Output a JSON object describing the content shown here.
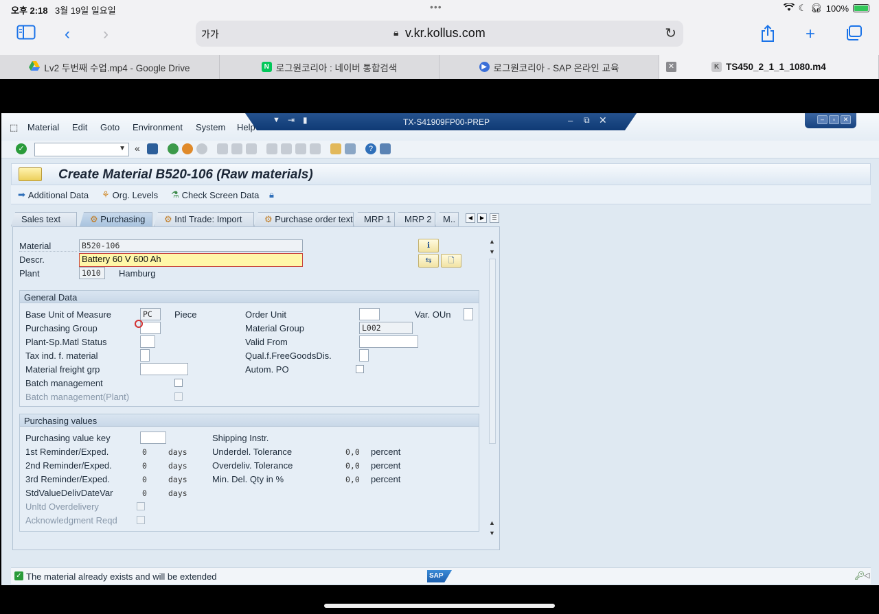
{
  "status_bar": {
    "time": "오후 2:18",
    "date": "3월 19일 일요일",
    "battery": "100%"
  },
  "browser": {
    "aa_label": "가가",
    "url": "v.kr.kollus.com",
    "tabs": [
      {
        "title": "Lv2 두번째 수업.mp4 - Google Drive",
        "icon": "google-drive-icon"
      },
      {
        "title": "로그원코리아 : 네이버 통합검색",
        "icon": "naver-icon"
      },
      {
        "title": "로그원코리아 - SAP 온라인 교육",
        "icon": "play-icon"
      },
      {
        "title": "TS450_2_1_1_1080.m4",
        "icon": "k-icon"
      }
    ]
  },
  "sap": {
    "menu": [
      "Material",
      "Edit",
      "Goto",
      "Environment",
      "System",
      "Help"
    ],
    "window_title": "TX-S41909FP00-PREP",
    "page_title": "Create Material B520-106 (Raw materials)",
    "app_toolbar": {
      "additional_data": "Additional Data",
      "org_levels": "Org. Levels",
      "check_screen": "Check Screen Data"
    },
    "tabs": [
      "Sales text",
      "Purchasing",
      "Intl Trade: Import",
      "Purchase order text",
      "MRP 1",
      "MRP 2",
      "M.."
    ],
    "active_tab": "Purchasing",
    "header": {
      "material_label": "Material",
      "material_value": "B520-106",
      "descr_label": "Descr.",
      "descr_value": "Battery 60 V 600 Ah",
      "plant_label": "Plant",
      "plant_value": "1010",
      "plant_name": "Hamburg"
    },
    "general_data": {
      "title": "General Data",
      "base_uom_label": "Base Unit of Measure",
      "base_uom_value": "PC",
      "base_uom_text": "Piece",
      "order_unit_label": "Order Unit",
      "var_oun_label": "Var. OUn",
      "purch_group_label": "Purchasing Group",
      "material_group_label": "Material Group",
      "material_group_value": "L002",
      "plant_status_label": "Plant-Sp.Matl Status",
      "valid_from_label": "Valid From",
      "tax_label": "Tax ind. f. material",
      "qual_label": "Qual.f.FreeGoodsDis.",
      "freight_label": "Material freight grp",
      "autom_po_label": "Autom. PO",
      "batch_label": "Batch management",
      "batch_plant_label": "Batch management(Plant)"
    },
    "purchasing_values": {
      "title": "Purchasing values",
      "value_key_label": "Purchasing value key",
      "shipping_label": "Shipping Instr.",
      "rem1_label": "1st Reminder/Exped.",
      "rem1_value": "0",
      "rem2_label": "2nd Reminder/Exped.",
      "rem2_value": "0",
      "rem3_label": "3rd Reminder/Exped.",
      "rem3_value": "0",
      "std_label": "StdValueDelivDateVar",
      "std_value": "0",
      "days": "days",
      "under_label": "Underdel. Tolerance",
      "under_value": "0,0",
      "over_label": "Overdeliv. Tolerance",
      "over_value": "0,0",
      "min_label": "Min. Del. Qty in %",
      "min_value": "0,0",
      "percent": "percent",
      "unltd_label": "Unltd Overdelivery",
      "ack_label": "Acknowledgment Reqd"
    },
    "status_message": "The material already exists and will be extended",
    "logo": "SAP"
  },
  "colors": {
    "sap_blue": "#0f3a75",
    "required_yellow": "#fff7a8",
    "ok_green": "#2a9b3a"
  }
}
